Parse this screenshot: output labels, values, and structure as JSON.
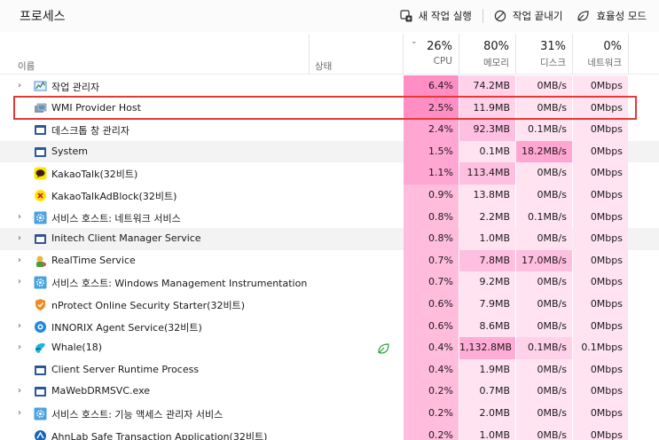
{
  "header": {
    "title": "프로세스",
    "new_task": "새 작업 실행",
    "end_task": "작업 끝내기",
    "efficiency": "효율성 모드"
  },
  "columns": {
    "name": "이름",
    "status": "상태",
    "cpu": {
      "pct": "26%",
      "label": "CPU"
    },
    "memory": {
      "pct": "80%",
      "label": "메모리"
    },
    "disk": {
      "pct": "31%",
      "label": "디스크"
    },
    "network": {
      "pct": "0%",
      "label": "네트워크"
    }
  },
  "colors": {
    "cpu_heat": [
      "#ffd6ec",
      "#ffbcdd",
      "#ffa6d2",
      "#ff8ec4"
    ],
    "selection": "#e53935",
    "leaf": "#2e9d3a"
  },
  "processes": [
    {
      "name": "작업 관리자",
      "icon": "task-manager-icon",
      "expand": true,
      "cpu": "6.4%",
      "mem": "74.2MB",
      "disk": "0MB/s",
      "net": "0Mbps",
      "cpu_h": 3,
      "mem_h": 1,
      "disk_h": 0
    },
    {
      "name": "WMI Provider Host",
      "icon": "wmi-icon",
      "expand": false,
      "cpu": "2.5%",
      "mem": "11.9MB",
      "disk": "0MB/s",
      "net": "0Mbps",
      "cpu_h": 3,
      "mem_h": 1,
      "disk_h": 0
    },
    {
      "name": "데스크톱 창 관리자",
      "icon": "window-icon",
      "expand": false,
      "cpu": "2.4%",
      "mem": "92.3MB",
      "disk": "0.1MB/s",
      "net": "0Mbps",
      "cpu_h": 2,
      "mem_h": 2,
      "disk_h": 0
    },
    {
      "name": "System",
      "icon": "window-icon",
      "expand": false,
      "cpu": "1.5%",
      "mem": "0.1MB",
      "disk": "18.2MB/s",
      "net": "0Mbps",
      "cpu_h": 2,
      "mem_h": 0,
      "disk_h": 3,
      "hl": true
    },
    {
      "name": "KakaoTalk(32비트)",
      "icon": "kakaotalk-icon",
      "expand": false,
      "cpu": "1.1%",
      "mem": "113.4MB",
      "disk": "0MB/s",
      "net": "0Mbps",
      "cpu_h": 2,
      "mem_h": 2,
      "disk_h": 0
    },
    {
      "name": "KakaoTalkAdBlock(32비트)",
      "icon": "adblock-icon",
      "expand": false,
      "cpu": "0.9%",
      "mem": "13.8MB",
      "disk": "0MB/s",
      "net": "0Mbps",
      "cpu_h": 1,
      "mem_h": 0,
      "disk_h": 0
    },
    {
      "name": "서비스 호스트: 네트워크 서비스",
      "icon": "gear-icon",
      "expand": true,
      "cpu": "0.8%",
      "mem": "2.2MB",
      "disk": "0.1MB/s",
      "net": "0Mbps",
      "cpu_h": 1,
      "mem_h": 0,
      "disk_h": 0
    },
    {
      "name": "Initech Client Manager Service",
      "icon": "window-icon",
      "expand": true,
      "cpu": "0.8%",
      "mem": "1.0MB",
      "disk": "0MB/s",
      "net": "0Mbps",
      "cpu_h": 1,
      "mem_h": 0,
      "disk_h": 0,
      "hl": true
    },
    {
      "name": "RealTime Service",
      "icon": "realtime-icon",
      "expand": true,
      "cpu": "0.7%",
      "mem": "7.8MB",
      "disk": "17.0MB/s",
      "net": "0Mbps",
      "cpu_h": 1,
      "mem_h": 2,
      "disk_h": 2
    },
    {
      "name": "서비스 호스트: Windows Management Instrumentation",
      "icon": "gear-icon",
      "expand": true,
      "cpu": "0.7%",
      "mem": "9.2MB",
      "disk": "0MB/s",
      "net": "0Mbps",
      "cpu_h": 1,
      "mem_h": 0,
      "disk_h": 0
    },
    {
      "name": "nProtect Online Security Starter(32비트)",
      "icon": "shield-icon",
      "expand": false,
      "cpu": "0.6%",
      "mem": "7.9MB",
      "disk": "0MB/s",
      "net": "0Mbps",
      "cpu_h": 1,
      "mem_h": 0,
      "disk_h": 0
    },
    {
      "name": "INNORIX Agent Service(32비트)",
      "icon": "innorix-icon",
      "expand": true,
      "cpu": "0.6%",
      "mem": "8.6MB",
      "disk": "0MB/s",
      "net": "0Mbps",
      "cpu_h": 1,
      "mem_h": 0,
      "disk_h": 0
    },
    {
      "name": "Whale(18)",
      "icon": "whale-icon",
      "expand": true,
      "cpu": "0.4%",
      "mem": "1,132.8MB",
      "disk": "0.1MB/s",
      "net": "0.1Mbps",
      "cpu_h": 1,
      "mem_h": 3,
      "disk_h": 1,
      "leaf": true
    },
    {
      "name": "Client Server Runtime Process",
      "icon": "window-icon",
      "expand": false,
      "cpu": "0.4%",
      "mem": "1.9MB",
      "disk": "0MB/s",
      "net": "0Mbps",
      "cpu_h": 1,
      "mem_h": 0,
      "disk_h": 0
    },
    {
      "name": "MaWebDRMSVC.exe",
      "icon": "window-icon",
      "expand": true,
      "cpu": "0.2%",
      "mem": "0.7MB",
      "disk": "0MB/s",
      "net": "0Mbps",
      "cpu_h": 1,
      "mem_h": 0,
      "disk_h": 0
    },
    {
      "name": "서비스 호스트: 기능 액세스 관리자 서비스",
      "icon": "gear-icon",
      "expand": true,
      "cpu": "0.2%",
      "mem": "2.0MB",
      "disk": "0MB/s",
      "net": "0Mbps",
      "cpu_h": 1,
      "mem_h": 0,
      "disk_h": 0
    },
    {
      "name": "AhnLab Safe Transaction Application(32비트)",
      "icon": "ahnlab-icon",
      "expand": false,
      "cpu": "0.2%",
      "mem": "1.0MB",
      "disk": "0MB/s",
      "net": "0Mbps",
      "cpu_h": 1,
      "mem_h": 0,
      "disk_h": 0
    }
  ]
}
